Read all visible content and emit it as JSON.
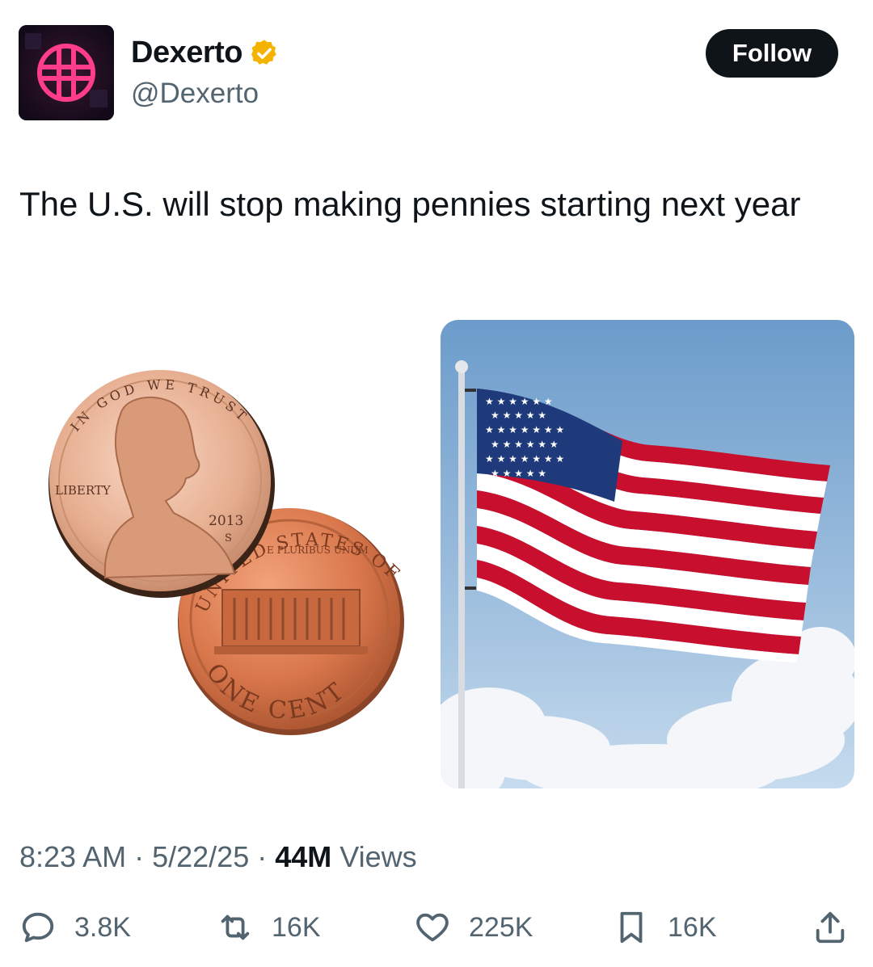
{
  "author": {
    "name": "Dexerto",
    "handle": "@Dexerto",
    "verified_color": "#f5b301"
  },
  "follow_label": "Follow",
  "tweet": {
    "text": "The U.S. will stop making pennies starting next year"
  },
  "penny": {
    "front_top_text": "IN GOD WE TRUST",
    "front_left_text": "LIBERTY",
    "year": "2013",
    "mint": "S",
    "back_top_text": "UNITED STATES OF AMERICA",
    "back_motto": "E PLURIBUS UNUM",
    "back_bottom_text": "ONE CENT"
  },
  "meta": {
    "time": "8:23 AM",
    "date": "5/22/25",
    "views_count": "44M",
    "views_label": "Views"
  },
  "actions": {
    "replies": "3.8K",
    "reposts": "16K",
    "likes": "225K",
    "bookmarks": "16K"
  },
  "colors": {
    "text_primary": "#0f1419",
    "text_secondary": "#536471",
    "avatar_accent": "#ff3d8a"
  }
}
